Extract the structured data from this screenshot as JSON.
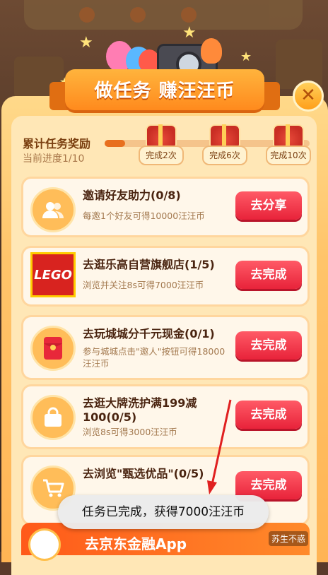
{
  "modal": {
    "title": "做任务 赚汪汪币",
    "close_symbol": "✕"
  },
  "progress": {
    "title": "累计任务奖励",
    "subtitle": "当前进度1/10",
    "fraction": 0.1,
    "milestones": [
      {
        "label": "完成2次"
      },
      {
        "label": "完成6次"
      },
      {
        "label": "完成10次"
      }
    ]
  },
  "tasks": [
    {
      "title": "邀请好友助力(0/8)",
      "desc": "每邀1个好友可得10000汪汪币",
      "button": "去分享",
      "icon": "friends-icon"
    },
    {
      "title": "去逛乐高自营旗舰店(1/5)",
      "desc": "浏览并关注8s可得7000汪汪币",
      "button": "去完成",
      "icon": "lego-logo",
      "logo_text": "LEGO"
    },
    {
      "title": "去玩城城分千元现金(0/1)",
      "desc": "参与城城点击\"邀人\"按钮可得18000汪汪币",
      "button": "去完成",
      "icon": "red-envelope-icon"
    },
    {
      "title": "去逛大牌洗护满199减100(0/5)",
      "desc": "浏览8s可得3000汪汪币",
      "button": "去完成",
      "icon": "shopping-bag-icon"
    },
    {
      "title": "去浏览\"甄选优品\"(0/5)",
      "desc": "",
      "button": "去完成",
      "icon": "shopping-cart-icon"
    }
  ],
  "bottom_bar": {
    "title": "去京东金融App"
  },
  "toast": {
    "text": "任务已完成，获得7000汪汪币"
  },
  "watermark": {
    "text": "苏生不惑"
  },
  "colors": {
    "accent": "#e8233a",
    "ribbon": "#ff8a1d",
    "card_bg": "#fff7ea",
    "annotation_arrow": "#e02020"
  }
}
